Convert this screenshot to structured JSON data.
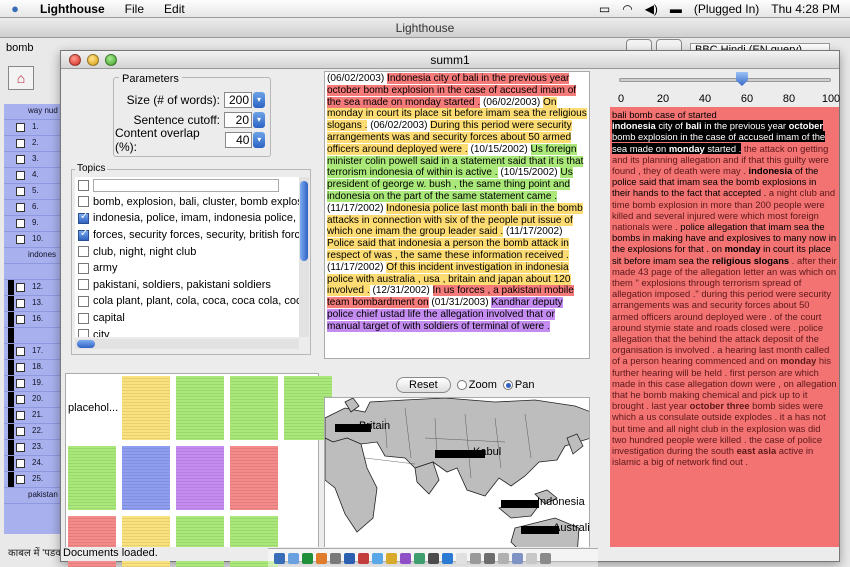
{
  "menubar": {
    "app_name": "Lighthouse",
    "menus": [
      "File",
      "Edit"
    ],
    "battery": "(Plugged In)",
    "clock": "Thu 4:28 PM"
  },
  "bg_window": {
    "title": "Lighthouse",
    "search_value": "bomb",
    "query_select": "BBC Hindi (EN query)",
    "left_items": [
      {
        "num": "",
        "text": "way nud"
      },
      {
        "num": "1.",
        "text": ""
      },
      {
        "num": "2.",
        "text": ""
      },
      {
        "num": "3.",
        "text": ""
      },
      {
        "num": "4.",
        "text": ""
      },
      {
        "num": "5.",
        "text": ""
      },
      {
        "num": "6.",
        "text": ""
      },
      {
        "num": "9.",
        "text": ""
      },
      {
        "num": "10.",
        "text": ""
      },
      {
        "num": "",
        "text": "indones"
      },
      {
        "num": "",
        "text": ""
      },
      {
        "num": "12.",
        "text": ""
      },
      {
        "num": "13.",
        "text": ""
      },
      {
        "num": "16.",
        "text": ""
      },
      {
        "num": "",
        "text": ""
      },
      {
        "num": "17.",
        "text": ""
      },
      {
        "num": "18.",
        "text": ""
      },
      {
        "num": "19.",
        "text": ""
      },
      {
        "num": "20.",
        "text": ""
      },
      {
        "num": "21.",
        "text": ""
      },
      {
        "num": "22.",
        "text": ""
      },
      {
        "num": "23.",
        "text": ""
      },
      {
        "num": "24.",
        "text": ""
      },
      {
        "num": "25.",
        "text": ""
      },
      {
        "num": "",
        "text": "pakistan"
      }
    ],
    "bottom_text": "काबल में 'पडव"
  },
  "window": {
    "title": "summ1",
    "status": "Documents loaded."
  },
  "parameters": {
    "legend": "Parameters",
    "size_label": "Size (# of words):",
    "size_value": "200",
    "cutoff_label": "Sentence cutoff:",
    "cutoff_value": "20",
    "overlap_label": "Content overlap (%):",
    "overlap_value": "40"
  },
  "topics": {
    "caption": "Topics",
    "items": [
      {
        "label": "",
        "checked": false
      },
      {
        "label": "bomb, explosion, bali, cluster, bomb explosi",
        "checked": false
      },
      {
        "label": "indonesia, police, imam, indonesia police, in",
        "checked": true
      },
      {
        "label": "forces, security forces, security, british force",
        "checked": true
      },
      {
        "label": "club, night, night club",
        "checked": false
      },
      {
        "label": "army",
        "checked": false
      },
      {
        "label": "pakistani, soldiers, pakistani soldiers",
        "checked": false
      },
      {
        "label": "cola plant, plant, cola, coca, coca cola, coca",
        "checked": false
      },
      {
        "label": "capital",
        "checked": false
      },
      {
        "label": "city",
        "checked": false
      }
    ]
  },
  "thumbnails": {
    "placeholder": "placehol...",
    "cards": [
      "#f9e27d",
      "#a9e879",
      "#a9e879",
      "#a9e879",
      "#a9e879",
      "#8e9df0",
      "#c48cf0",
      "#f48a8a",
      "#f48a8a",
      "#f9e27d",
      "#a9e879",
      "#a9e879"
    ]
  },
  "summary": {
    "segments": [
      {
        "t": "(06/02/2003) ",
        "c": ""
      },
      {
        "t": "Indonesia city of bali in the previous year october bomb explosion in the case of accused imam of the sea made on monday started .",
        "c": "r"
      },
      {
        "t": " (06/02/2003) ",
        "c": ""
      },
      {
        "t": "On monday in court its place sit before imam sea the religious slogans .",
        "c": "y"
      },
      {
        "t": " (06/02/2003) ",
        "c": ""
      },
      {
        "t": "During this period were security arrangements was and security forces about 50 armed officers around deployed were .",
        "c": "y"
      },
      {
        "t": " (10/15/2002) ",
        "c": ""
      },
      {
        "t": "Us foreign minister colin powell said in a statement said that it is that terrorism indonesia of within is active .",
        "c": "g"
      },
      {
        "t": " (10/15/2002) ",
        "c": ""
      },
      {
        "t": "Us president of george w. bush , the same thing point and indonesia on the part of the same statement came .",
        "c": "g"
      },
      {
        "t": " (11/17/2002) ",
        "c": ""
      },
      {
        "t": "Indonesia police last month bali in the bomb attacks in connection with six of the people put issue of which one imam the group leader said .",
        "c": "y"
      },
      {
        "t": " (11/17/2002) ",
        "c": ""
      },
      {
        "t": "Police said that indonesia a person the bomb attack in respect of was , the same these information received .",
        "c": "y"
      },
      {
        "t": " (11/17/2002) ",
        "c": ""
      },
      {
        "t": "Of this incident investigation in indonesia police with australia , usa , britain and japan about 120 involved .",
        "c": "y"
      },
      {
        "t": " (12/31/2002) ",
        "c": ""
      },
      {
        "t": "In us forces , a pakistani mobile team bombardment on",
        "c": "r"
      },
      {
        "t": " (01/31/2003) ",
        "c": ""
      },
      {
        "t": "Kandhar deputy police chief ustad life the allegation involved that or manual target of with soldiers of terminal of were .",
        "c": "p"
      }
    ]
  },
  "map": {
    "reset_label": "Reset",
    "zoom_label": "Zoom",
    "pan_label": "Pan",
    "mode": "Pan",
    "labels": [
      "Britain",
      "Kabul",
      "Indonesia",
      "Australia"
    ]
  },
  "slider": {
    "ticks": [
      "0",
      "20",
      "40",
      "60",
      "80",
      "100"
    ],
    "value_pct": 58
  },
  "right_text": {
    "title": "bali bomb case of started",
    "segments": [
      {
        "t": "indonesia",
        "c": "hi b"
      },
      {
        "t": " city of ",
        "c": "hi"
      },
      {
        "t": "bali",
        "c": "hi b"
      },
      {
        "t": " in the previous year ",
        "c": "hi"
      },
      {
        "t": "october",
        "c": "hi b"
      },
      {
        "t": " bomb explosion in the case of accused imam of the sea made on ",
        "c": "hi"
      },
      {
        "t": "monday",
        "c": "hi b"
      },
      {
        "t": " started .",
        "c": "hi"
      },
      {
        "t": " the attack on getting and its planning allegation and if that this guilty were found , they of death were may . ",
        "c": "dim"
      },
      {
        "t": "indonesia",
        "c": "dk b"
      },
      {
        "t": " of the police said that imam sea the bomb explosions in their hands to the fact that accepted . ",
        "c": "dk"
      },
      {
        "t": "a night club and time bomb explosion in more than 200 people were killed and several injured were which most foreign nationals were",
        "c": "dim"
      },
      {
        "t": " . police allegation that imam sea the bombs in making have and explosives to many now in the explosions for that",
        "c": "dk"
      },
      {
        "t": " . on ",
        "c": "dk"
      },
      {
        "t": "monday",
        "c": "dk b"
      },
      {
        "t": " in court its place sit before imam sea the ",
        "c": "dk"
      },
      {
        "t": "religious slogans",
        "c": "dk b"
      },
      {
        "t": " . after their made 43 page of the allegation letter an was which on them \" explosions through terrorism spread of allegation imposed .\" during this period were security arrangements was and security forces about 50 armed officers around deployed were . of the court around stymie state and roads closed were . police allegation that the behind the attack deposit of the organisation is involved . a hearing last month called of a person hearing commenced and on ",
        "c": "dim"
      },
      {
        "t": "monday",
        "c": "dim b"
      },
      {
        "t": " his further hearing will be held . first person are which made in this case allegation down were , on allegation that he bomb making chemical and pick up to it brought . last year ",
        "c": "dim"
      },
      {
        "t": "october three",
        "c": "dim b"
      },
      {
        "t": " bomb sides were which a us consulate outside explodes . it a has not but time and all night club in the explosion was did two hundred people were killed . the case of police investigation during the south ",
        "c": "dim"
      },
      {
        "t": "east asia",
        "c": "dim b"
      },
      {
        "t": " active in islamic a big of network find out .",
        "c": "dim"
      }
    ]
  }
}
